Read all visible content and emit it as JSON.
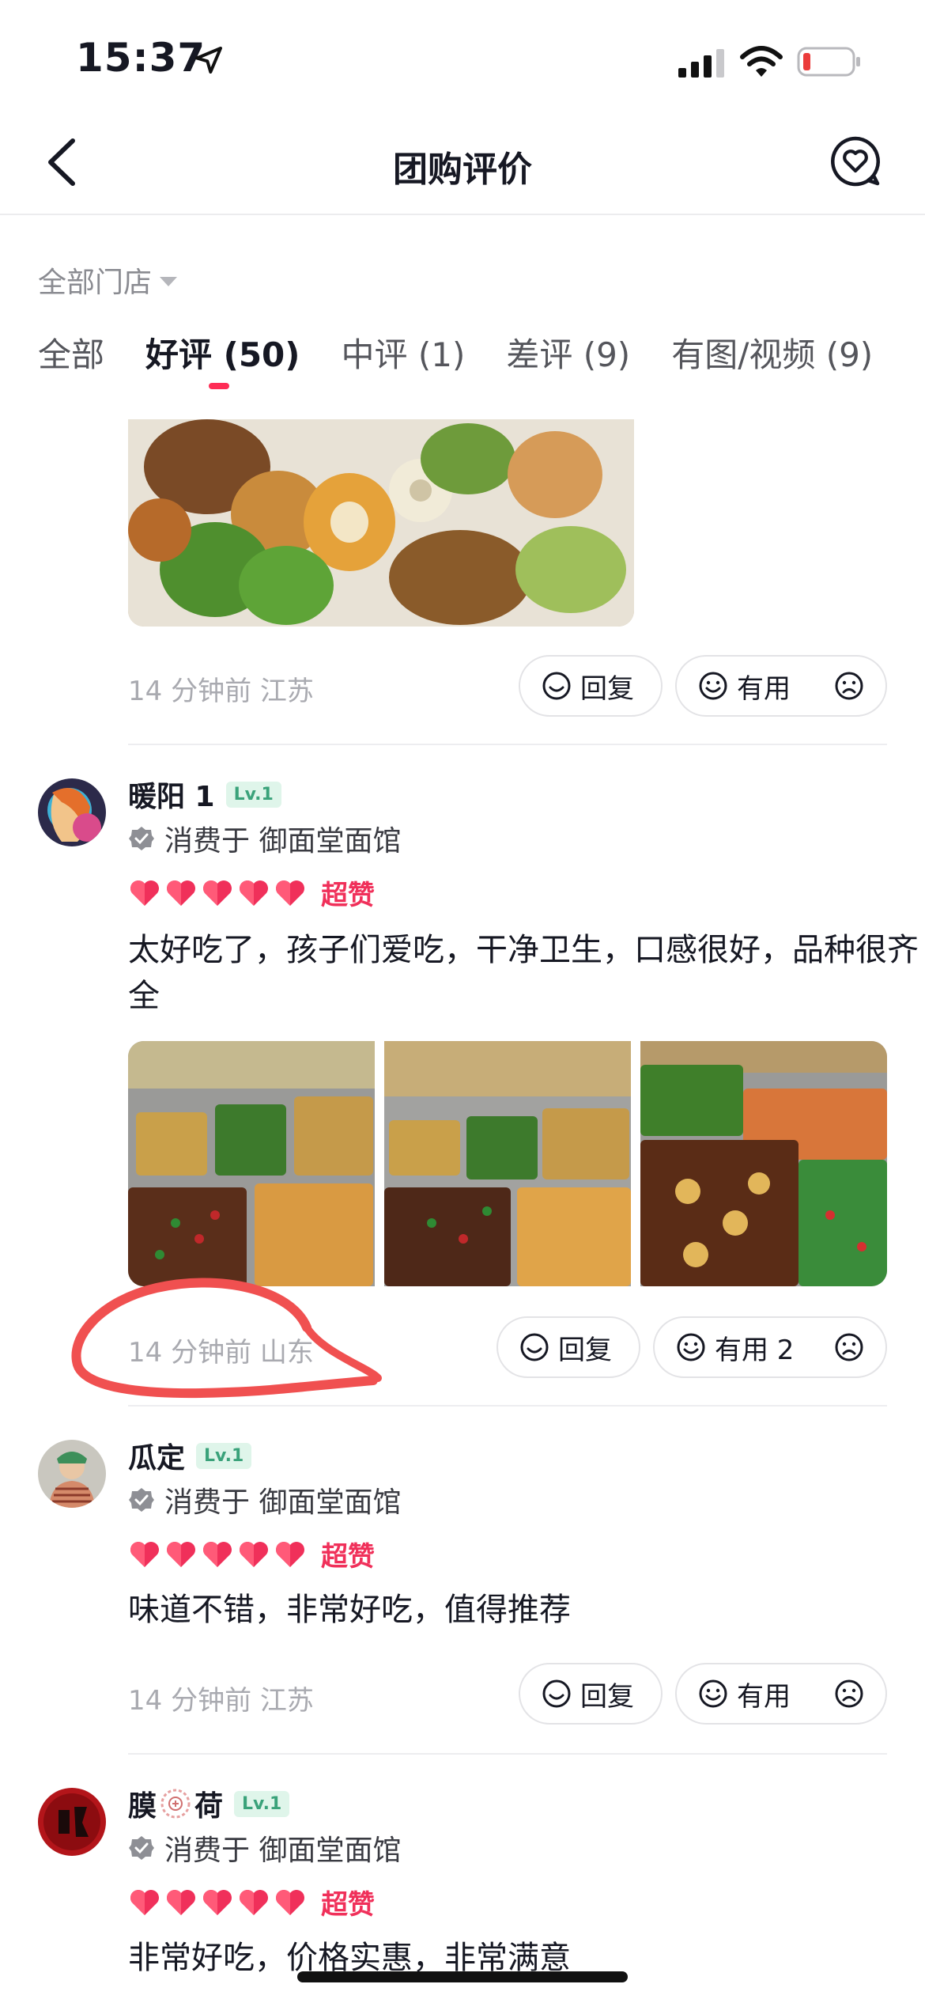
{
  "status_bar": {
    "time": "15:37"
  },
  "nav": {
    "title": "团购评价"
  },
  "filter": {
    "store_label": "全部门店"
  },
  "tabs": [
    {
      "label": "全部",
      "active": false
    },
    {
      "label": "好评 (50)",
      "active": true
    },
    {
      "label": "中评 (1)",
      "active": false
    },
    {
      "label": "差评 (9)",
      "active": false
    },
    {
      "label": "有图/视频 (9)",
      "active": false
    }
  ],
  "colors": {
    "accent": "#fe2c55",
    "heart": "#f0305a",
    "annotation": "#f05050"
  },
  "actions": {
    "reply": "回复",
    "useful": "有用"
  },
  "reviews": [
    {
      "meta": "14 分钟前  江苏",
      "useful_label": "有用"
    },
    {
      "username": "暖阳 1",
      "level": "Lv.1",
      "consumed_at": "消费于 御面堂面馆",
      "rating_label": "超赞",
      "stars": 5,
      "text": "太好吃了，孩子们爱吃，干净卫生，口感很好，品种很齐全",
      "photo_count": 3,
      "meta": "14 分钟前  山东",
      "useful_label": "有用 2"
    },
    {
      "username": "瓜定",
      "level": "Lv.1",
      "consumed_at": "消费于 御面堂面馆",
      "rating_label": "超赞",
      "stars": 5,
      "text": "味道不错，非常好吃，值得推荐",
      "meta": "14 分钟前  江苏",
      "useful_label": "有用"
    },
    {
      "username_pre": "膜",
      "username_post": "荷",
      "level": "Lv.1",
      "consumed_at": "消费于 御面堂面馆",
      "rating_label": "超赞",
      "stars": 5,
      "text": "非常好吃，价格实惠，非常满意"
    }
  ]
}
